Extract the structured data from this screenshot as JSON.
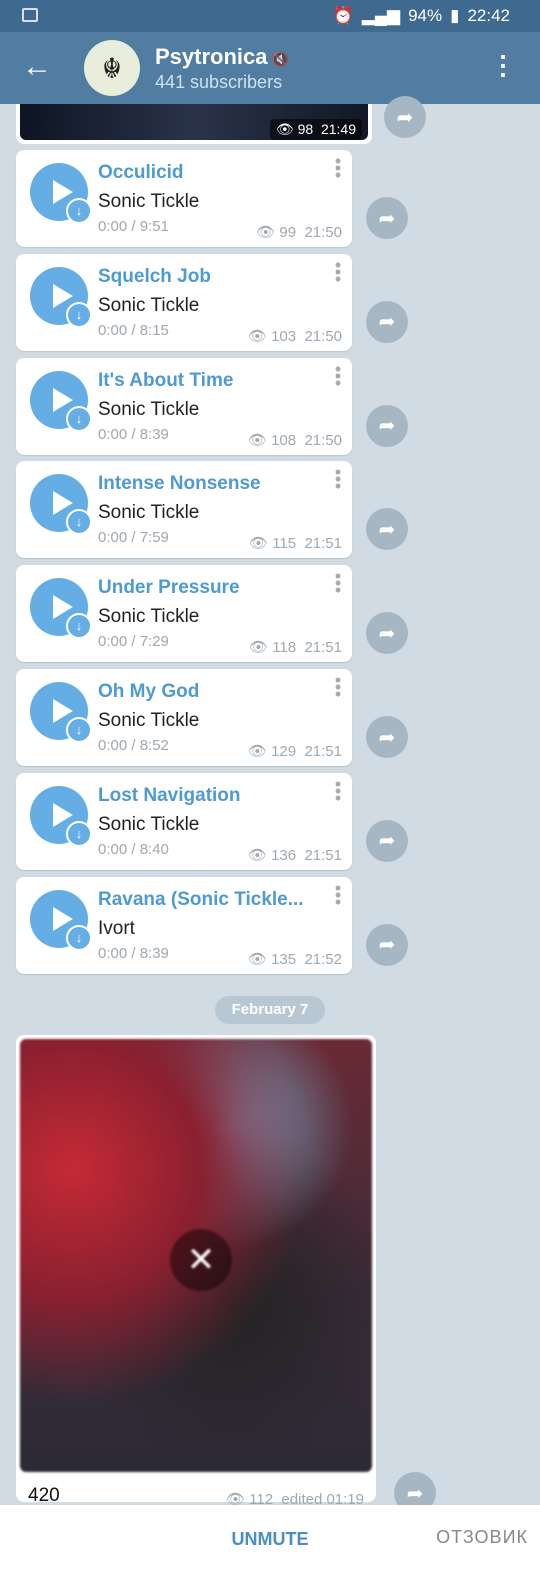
{
  "status": {
    "battery": "94%",
    "time": "22:42"
  },
  "header": {
    "title": "Psytronica",
    "subtitle": "441 subscribers"
  },
  "top_message": {
    "views": "98",
    "time": "21:49"
  },
  "tracks": [
    {
      "title": "Occulicid",
      "artist": "Sonic Tickle",
      "progress": "0:00 / 9:51",
      "views": "99",
      "time": "21:50"
    },
    {
      "title": "Squelch Job",
      "artist": "Sonic Tickle",
      "progress": "0:00 / 8:15",
      "views": "103",
      "time": "21:50"
    },
    {
      "title": "It's About Time",
      "artist": "Sonic Tickle",
      "progress": "0:00 / 8:39",
      "views": "108",
      "time": "21:50"
    },
    {
      "title": "Intense Nonsense",
      "artist": "Sonic Tickle",
      "progress": "0:00 / 7:59",
      "views": "115",
      "time": "21:51"
    },
    {
      "title": "Under Pressure",
      "artist": "Sonic Tickle",
      "progress": "0:00 / 7:29",
      "views": "118",
      "time": "21:51"
    },
    {
      "title": "Oh My God",
      "artist": "Sonic Tickle",
      "progress": "0:00 / 8:52",
      "views": "129",
      "time": "21:51"
    },
    {
      "title": "Lost Navigation",
      "artist": "Sonic Tickle",
      "progress": "0:00 / 8:40",
      "views": "136",
      "time": "21:51"
    },
    {
      "title": "Ravana (Sonic Tickle...",
      "artist": "Ivort",
      "progress": "0:00 / 8:39",
      "views": "135",
      "time": "21:52"
    }
  ],
  "date_divider": "February 7",
  "photo_message": {
    "caption": "420",
    "views": "112",
    "time": "edited 01:19"
  },
  "bottom": {
    "unmute": "UNMUTE",
    "watermark": "ОТЗОВИК"
  },
  "colors": {
    "header": "#517da2",
    "accent": "#65aee5",
    "title": "#4e9ad2"
  }
}
